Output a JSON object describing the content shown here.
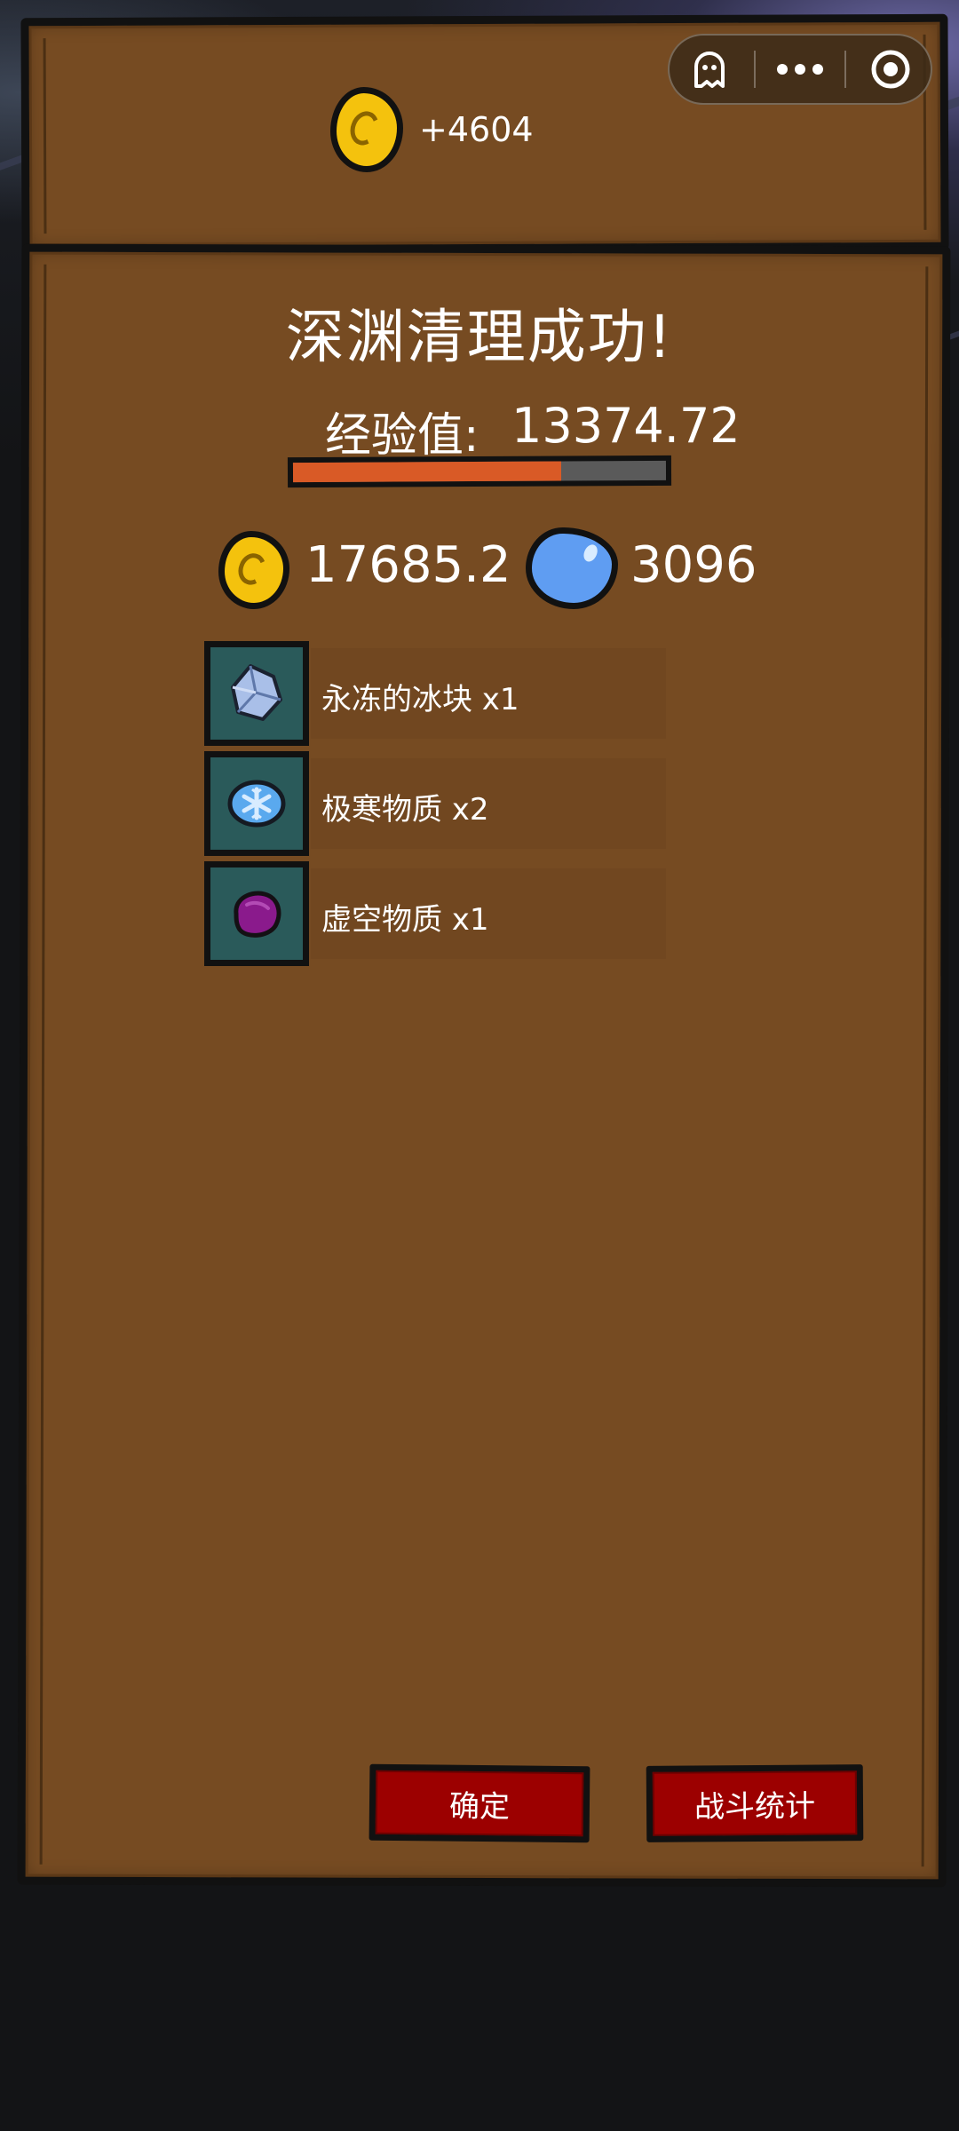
{
  "top_banner": {
    "gold_gain": "+4604"
  },
  "capsule_menu": {
    "items": [
      "ghost-icon",
      "more-dots-icon",
      "close-circle-icon"
    ]
  },
  "result": {
    "title": "深渊清理成功!",
    "exp_label": "经验值:",
    "exp_value": "13374.72",
    "exp_progress": 0.72,
    "gold_total": "17685.2",
    "gem_total": "3096"
  },
  "rewards": [
    {
      "label": "永冻的冰块 x1",
      "icon": "ice-crystal-icon"
    },
    {
      "label": "极寒物质 x2",
      "icon": "frost-matter-icon"
    },
    {
      "label": "虚空物质 x1",
      "icon": "void-matter-icon"
    }
  ],
  "buttons": {
    "confirm": "确定",
    "battle_stats": "战斗统计"
  },
  "colors": {
    "panel": "#764b22",
    "button": "#9c0000",
    "slot": "#2a5a5a",
    "exp_fill": "#d95a26",
    "coin": "#f4c20d",
    "gem": "#5f9df2"
  }
}
